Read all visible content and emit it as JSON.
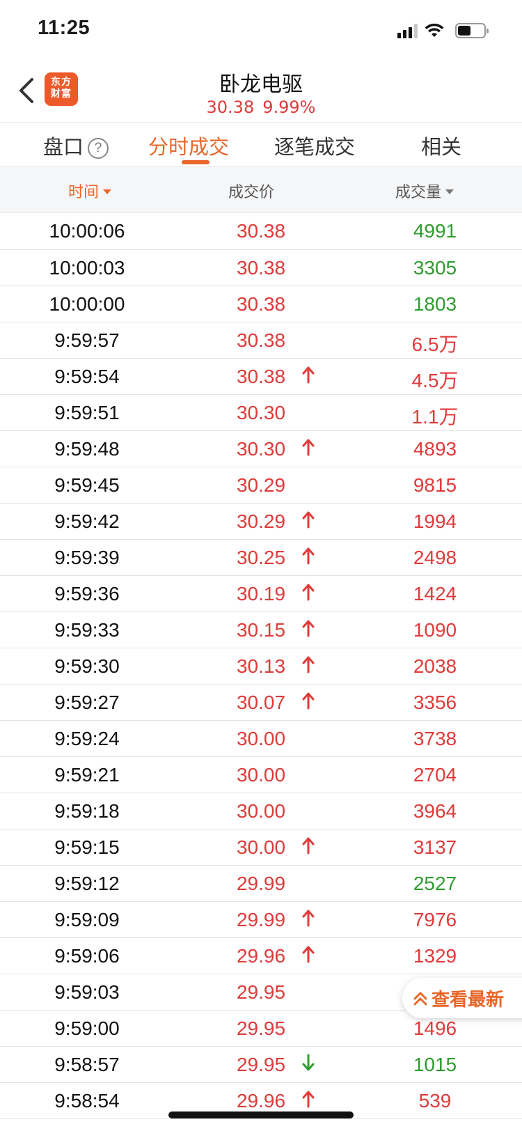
{
  "status_bar": {
    "time": "11:25"
  },
  "header": {
    "logo_line1": "东方",
    "logo_line2": "财富",
    "stock_name": "卧龙电驱",
    "price": "30.38",
    "change_pct": "9.99%"
  },
  "tabs": [
    {
      "label": "盘口"
    },
    {
      "label": "分时成交",
      "active": true
    },
    {
      "label": "逐笔成交"
    },
    {
      "label": "相关"
    }
  ],
  "help_icon_text": "?",
  "columns": {
    "time": "时间",
    "price": "成交价",
    "volume": "成交量"
  },
  "trades": [
    {
      "time": "10:00:06",
      "price": "30.38",
      "arrow": "",
      "volume": "4991",
      "vol_color": "green"
    },
    {
      "time": "10:00:03",
      "price": "30.38",
      "arrow": "",
      "volume": "3305",
      "vol_color": "green"
    },
    {
      "time": "10:00:00",
      "price": "30.38",
      "arrow": "",
      "volume": "1803",
      "vol_color": "green"
    },
    {
      "time": "9:59:57",
      "price": "30.38",
      "arrow": "",
      "volume": "6.5万",
      "vol_color": "red"
    },
    {
      "time": "9:59:54",
      "price": "30.38",
      "arrow": "up",
      "volume": "4.5万",
      "vol_color": "red"
    },
    {
      "time": "9:59:51",
      "price": "30.30",
      "arrow": "",
      "volume": "1.1万",
      "vol_color": "red"
    },
    {
      "time": "9:59:48",
      "price": "30.30",
      "arrow": "up",
      "volume": "4893",
      "vol_color": "red"
    },
    {
      "time": "9:59:45",
      "price": "30.29",
      "arrow": "",
      "volume": "9815",
      "vol_color": "red"
    },
    {
      "time": "9:59:42",
      "price": "30.29",
      "arrow": "up",
      "volume": "1994",
      "vol_color": "red"
    },
    {
      "time": "9:59:39",
      "price": "30.25",
      "arrow": "up",
      "volume": "2498",
      "vol_color": "red"
    },
    {
      "time": "9:59:36",
      "price": "30.19",
      "arrow": "up",
      "volume": "1424",
      "vol_color": "red"
    },
    {
      "time": "9:59:33",
      "price": "30.15",
      "arrow": "up",
      "volume": "1090",
      "vol_color": "red"
    },
    {
      "time": "9:59:30",
      "price": "30.13",
      "arrow": "up",
      "volume": "2038",
      "vol_color": "red"
    },
    {
      "time": "9:59:27",
      "price": "30.07",
      "arrow": "up",
      "volume": "3356",
      "vol_color": "red"
    },
    {
      "time": "9:59:24",
      "price": "30.00",
      "arrow": "",
      "volume": "3738",
      "vol_color": "red"
    },
    {
      "time": "9:59:21",
      "price": "30.00",
      "arrow": "",
      "volume": "2704",
      "vol_color": "red"
    },
    {
      "time": "9:59:18",
      "price": "30.00",
      "arrow": "",
      "volume": "3964",
      "vol_color": "red"
    },
    {
      "time": "9:59:15",
      "price": "30.00",
      "arrow": "up",
      "volume": "3137",
      "vol_color": "red"
    },
    {
      "time": "9:59:12",
      "price": "29.99",
      "arrow": "",
      "volume": "2527",
      "vol_color": "green"
    },
    {
      "time": "9:59:09",
      "price": "29.99",
      "arrow": "up",
      "volume": "7976",
      "vol_color": "red"
    },
    {
      "time": "9:59:06",
      "price": "29.96",
      "arrow": "up",
      "volume": "1329",
      "vol_color": "red"
    },
    {
      "time": "9:59:03",
      "price": "29.95",
      "arrow": "",
      "volume": "",
      "vol_color": "red"
    },
    {
      "time": "9:59:00",
      "price": "29.95",
      "arrow": "",
      "volume": "1496",
      "vol_color": "red"
    },
    {
      "time": "9:58:57",
      "price": "29.95",
      "arrow": "down",
      "volume": "1015",
      "vol_color": "green"
    },
    {
      "time": "9:58:54",
      "price": "29.96",
      "arrow": "up",
      "volume": "539",
      "vol_color": "red"
    }
  ],
  "latest_button": {
    "label": "查看最新"
  },
  "colors": {
    "accent": "#e8672a",
    "up": "#e03a3a",
    "down": "#2f9c2f",
    "logo": "#ec5a2b"
  },
  "icons": {
    "back": "chevron-left-icon",
    "help": "question-circle-icon",
    "up_arrow": "arrow-up-icon",
    "down_arrow": "arrow-down-icon",
    "latest": "double-chevron-up-icon"
  }
}
